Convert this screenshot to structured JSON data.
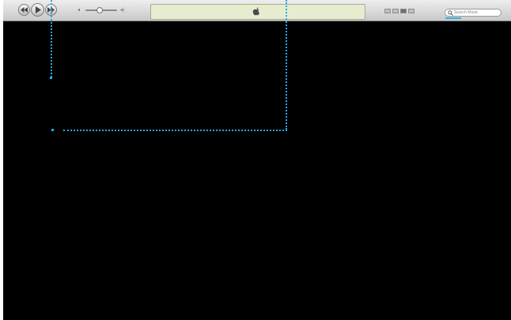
{
  "toolbar": {
    "buttons": [
      {
        "name": "previous-button",
        "icon": "rewind-icon"
      },
      {
        "name": "play-button",
        "icon": "play-icon"
      },
      {
        "name": "next-button",
        "icon": "fast-forward-icon"
      }
    ],
    "volume": {
      "level": 0.45,
      "low_icon": "speaker-low-icon",
      "high_icon": "speaker-high-icon"
    },
    "display": {
      "icon": "apple-logo-icon",
      "background": "#e6ecd0"
    },
    "view_buttons": [
      "list-view",
      "album-view",
      "grid-view",
      "cover-flow-view"
    ],
    "active_view_index": 2,
    "search": {
      "placeholder": "Search Music"
    }
  },
  "top_note": "",
  "colors": {
    "guide": "#2aa8e6",
    "content_bg": "#000000",
    "toolbar_bg": "#d6d6d6"
  }
}
